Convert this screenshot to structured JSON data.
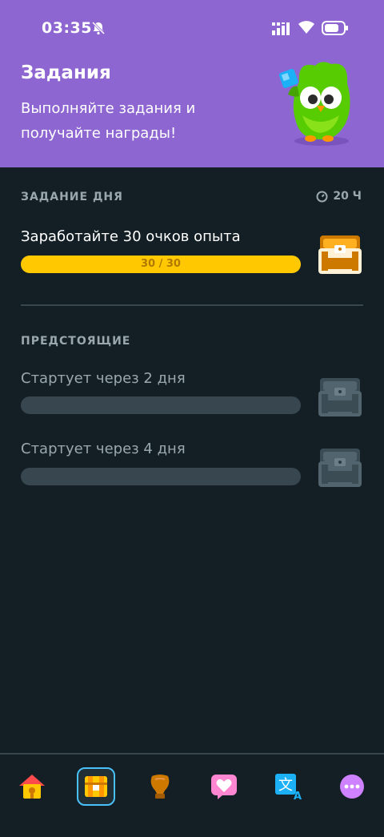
{
  "status_bar": {
    "time": "03:35"
  },
  "header": {
    "title": "Задания",
    "subtitle": "Выполняйте задания и получайте награды!"
  },
  "daily": {
    "section_label": "ЗАДАНИЕ ДНЯ",
    "timer": "20 Ч",
    "quest": {
      "text": "Заработайте 30 очков опыта",
      "progress_label": "30 / 30",
      "progress": 1.0
    }
  },
  "upcoming": {
    "section_label": "ПРЕДСТОЯЩИЕ",
    "items": [
      {
        "text": "Стартует через 2 дня",
        "progress": 0
      },
      {
        "text": "Стартует через 4 дня",
        "progress": 0
      }
    ]
  },
  "nav": {
    "items": [
      {
        "icon": "home-icon"
      },
      {
        "icon": "quests-chest-icon",
        "active": true
      },
      {
        "icon": "leaderboard-icon"
      },
      {
        "icon": "friends-heart-icon"
      },
      {
        "icon": "translate-icon"
      },
      {
        "icon": "more-icon"
      }
    ]
  },
  "colors": {
    "header_bg": "#8e66d1",
    "page_bg": "#131f24",
    "progress_fill": "#ffc800",
    "active_nav_border": "#49c0f8"
  }
}
